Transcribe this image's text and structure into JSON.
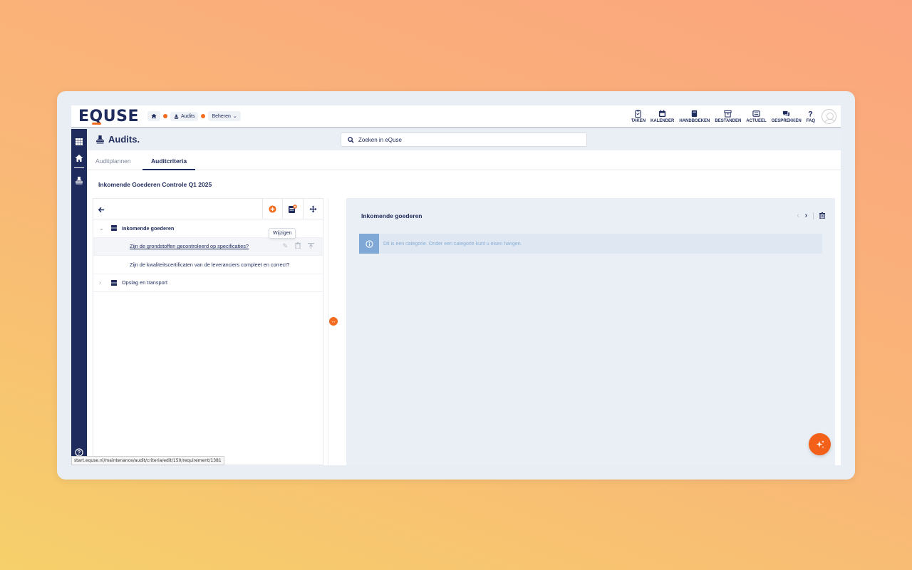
{
  "logo": {
    "pre": "E",
    "q": "Q",
    "post": "USE"
  },
  "breadcrumb": {
    "home": "⌂",
    "audits": "Audits",
    "manage": "Beheren"
  },
  "topnav": [
    {
      "label": "TAKEN",
      "icon": "clipboard-icon"
    },
    {
      "label": "KALENDER",
      "icon": "calendar-icon"
    },
    {
      "label": "HANDBOEKEN",
      "icon": "book-icon"
    },
    {
      "label": "BESTANDEN",
      "icon": "archive-icon"
    },
    {
      "label": "ACTUEEL",
      "icon": "newspaper-icon"
    },
    {
      "label": "GESPREKKEN",
      "icon": "chat-icon"
    },
    {
      "label": "FAQ",
      "icon": "question-icon"
    }
  ],
  "page": {
    "title": "Audits."
  },
  "search": {
    "placeholder": "Zoeken in eQuse"
  },
  "tabs": {
    "plans": "Auditplannen",
    "criteria": "Auditcriteria"
  },
  "audit": {
    "title": "Inkomende Goederen Controle Q1 2025"
  },
  "tree": {
    "items": [
      {
        "label": "Inkomende goederen",
        "type": "category",
        "expanded": true
      },
      {
        "label": "Zijn de grondstoffen gecontroleerd op specificaties?",
        "type": "requirement"
      },
      {
        "label": "Zijn de kwaliteitscertificaten van de leveranciers compleet en correct?",
        "type": "requirement"
      },
      {
        "label": "Opslag en transport",
        "type": "category",
        "expanded": false
      }
    ],
    "tooltip": "Wijzigen"
  },
  "detail": {
    "title": "Inkomende goederen",
    "info": "Dit is een categorie. Onder een categorie kunt u eisen hangen."
  },
  "status_url": "start.equse.nl/maintenance/audit/criteria/edit/150/requirement/1381",
  "colors": {
    "brand": "#1f2b5c",
    "accent": "#f26b1f"
  }
}
